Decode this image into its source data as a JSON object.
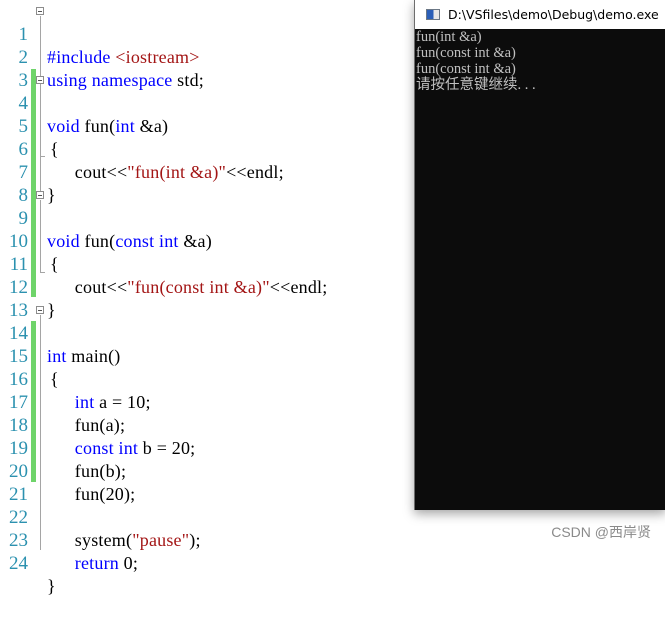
{
  "editor": {
    "lines": [
      {
        "num": "1"
      },
      {
        "num": "2"
      },
      {
        "num": "3"
      },
      {
        "num": "4"
      },
      {
        "num": "5"
      },
      {
        "num": "6"
      },
      {
        "num": "7"
      },
      {
        "num": "8"
      },
      {
        "num": "9"
      },
      {
        "num": "10"
      },
      {
        "num": "11"
      },
      {
        "num": "12"
      },
      {
        "num": "13"
      },
      {
        "num": "14"
      },
      {
        "num": "15"
      },
      {
        "num": "16"
      },
      {
        "num": "17"
      },
      {
        "num": "18"
      },
      {
        "num": "19"
      },
      {
        "num": "20"
      },
      {
        "num": "21"
      },
      {
        "num": "22"
      },
      {
        "num": "23"
      },
      {
        "num": "24"
      }
    ],
    "tokens": {
      "l1_directive": "#include",
      "l1_header": " <iostream>",
      "l2_kw1": "using",
      "l2_kw2": " namespace",
      "l2_rest": " std;",
      "l4_kw": "void",
      "l4_rest1": " fun(",
      "l4_kw2": "int",
      "l4_rest2": " &a)",
      "l5": "{",
      "l6_pre": "    cout<<",
      "l6_str": "\"fun(int &a)\"",
      "l6_post": "<<endl;",
      "l7": "}",
      "l9_kw": "void",
      "l9_rest1": " fun(",
      "l9_kw2": "const",
      "l9_sp": " ",
      "l9_kw3": "int",
      "l9_rest2": " &a)",
      "l10": "{",
      "l11_pre": "    cout<<",
      "l11_str": "\"fun(const int &a)\"",
      "l11_post": "<<endl;",
      "l12": "}",
      "l14_kw": "int",
      "l14_rest": " main()",
      "l15": "{",
      "l16_kw": "    int",
      "l16_rest": " a = 10;",
      "l17": "    fun(a);",
      "l18_kw1": "    const",
      "l18_kw2": " int",
      "l18_rest": " b = 20;",
      "l19": "    fun(b);",
      "l20": "    fun(20);",
      "l22_pre": "    system(",
      "l22_str": "\"pause\"",
      "l22_post": ");",
      "l23_kw": "    return",
      "l23_rest": " 0;",
      "l24": "}"
    }
  },
  "console": {
    "title": "D:\\VSfiles\\demo\\Debug\\demo.exe",
    "icon": "console-app-icon",
    "output": [
      "fun(int &a)",
      "fun(const int &a)",
      "fun(const int &a)",
      "请按任意键继续. . ."
    ]
  },
  "watermark": "CSDN @西岸贤"
}
